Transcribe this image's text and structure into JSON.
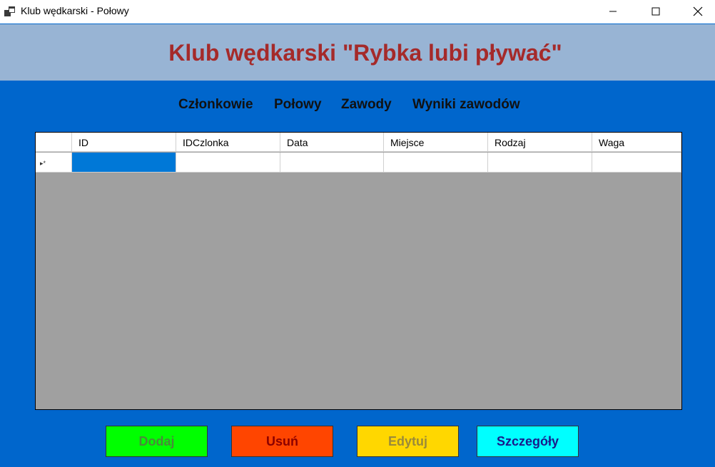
{
  "window": {
    "title": "Klub wędkarski - Połowy"
  },
  "header": {
    "title": "Klub wędkarski \"Rybka lubi pływać\""
  },
  "menu": {
    "items": [
      {
        "label": "Członkowie"
      },
      {
        "label": "Połowy"
      },
      {
        "label": "Zawody"
      },
      {
        "label": "Wyniki zawodów"
      }
    ]
  },
  "grid": {
    "columns": [
      "ID",
      "IDCzlonka",
      "Data",
      "Miejsce",
      "Rodzaj",
      "Waga"
    ],
    "new_row_indicator": "▸*",
    "rows": []
  },
  "buttons": {
    "add": "Dodaj",
    "delete": "Usuń",
    "edit": "Edytuj",
    "details": "Szczegóły"
  },
  "colors": {
    "background": "#0066cc",
    "banner": "#98b4d4",
    "title": "#a52a2a",
    "add_button": "#00ff00",
    "delete_button": "#ff4500",
    "edit_button": "#ffd700",
    "details_button": "#00ffff",
    "selected_cell": "#0078d7"
  },
  "icons": {
    "app": "app-window-icon",
    "minimize": "minimize-icon",
    "maximize": "maximize-icon",
    "close": "close-icon"
  }
}
